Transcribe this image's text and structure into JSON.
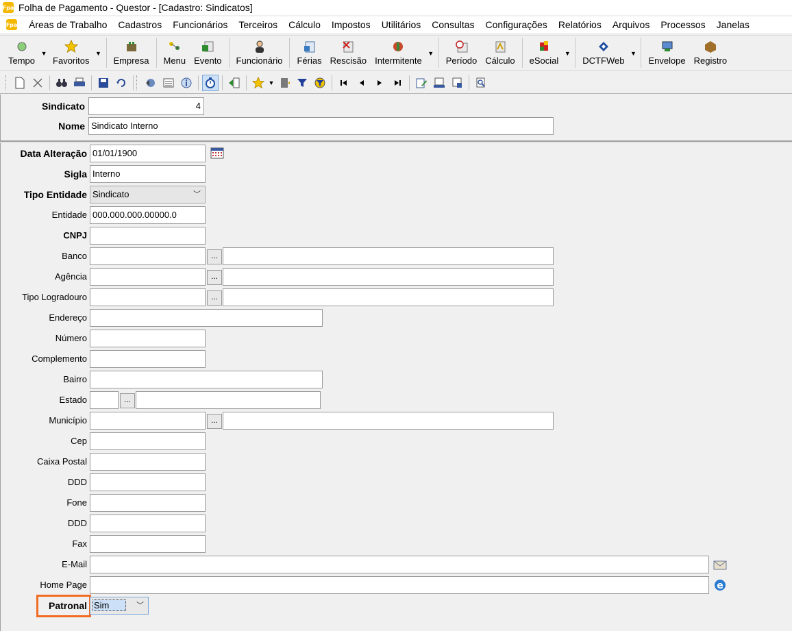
{
  "window": {
    "title": "Folha de Pagamento - Questor - [Cadastro: Sindicatos]",
    "logo_text": "Fpa"
  },
  "menu": [
    "Áreas de Trabalho",
    "Cadastros",
    "Funcionários",
    "Terceiros",
    "Cálculo",
    "Impostos",
    "Utilitários",
    "Consultas",
    "Configurações",
    "Relatórios",
    "Arquivos",
    "Processos",
    "Janelas"
  ],
  "toolbar": {
    "tempo": "Tempo",
    "favoritos": "Favoritos",
    "empresa": "Empresa",
    "menu": "Menu",
    "evento": "Evento",
    "funcionario": "Funcionário",
    "ferias": "Férias",
    "rescisao": "Rescisão",
    "intermitente": "Intermitente",
    "periodo": "Período",
    "calculo": "Cálculo",
    "esocial": "eSocial",
    "dctfweb": "DCTFWeb",
    "envelope": "Envelope",
    "registro": "Registro"
  },
  "form": {
    "sindicato": {
      "label": "Sindicato",
      "value": "4"
    },
    "nome": {
      "label": "Nome",
      "value": "Sindicato Interno"
    },
    "data_alteracao": {
      "label": "Data Alteração",
      "value": "01/01/1900"
    },
    "sigla": {
      "label": "Sigla",
      "value": "Interno"
    },
    "tipo_entidade": {
      "label": "Tipo Entidade",
      "value": "Sindicato"
    },
    "entidade": {
      "label": "Entidade",
      "value": "000.000.000.00000.0"
    },
    "cnpj": {
      "label": "CNPJ",
      "value": ""
    },
    "banco": {
      "label": "Banco",
      "value": ""
    },
    "agencia": {
      "label": "Agência",
      "value": ""
    },
    "tipo_logradouro": {
      "label": "Tipo Logradouro",
      "value": ""
    },
    "endereco": {
      "label": "Endereço",
      "value": ""
    },
    "numero": {
      "label": "Número",
      "value": ""
    },
    "complemento": {
      "label": "Complemento",
      "value": ""
    },
    "bairro": {
      "label": "Bairro",
      "value": ""
    },
    "estado": {
      "label": "Estado",
      "value": ""
    },
    "municipio": {
      "label": "Município",
      "value": ""
    },
    "cep": {
      "label": "Cep",
      "value": ""
    },
    "caixa_postal": {
      "label": "Caixa Postal",
      "value": ""
    },
    "ddd1": {
      "label": "DDD",
      "value": ""
    },
    "fone": {
      "label": "Fone",
      "value": ""
    },
    "ddd2": {
      "label": "DDD",
      "value": ""
    },
    "fax": {
      "label": "Fax",
      "value": ""
    },
    "email": {
      "label": "E-Mail",
      "value": ""
    },
    "home_page": {
      "label": "Home Page",
      "value": ""
    },
    "patronal": {
      "label": "Patronal",
      "value": "Sim"
    },
    "lookup_button": "..."
  },
  "colors": {
    "highlight": "#f26b22",
    "window_bg": "#f0f0f0"
  }
}
